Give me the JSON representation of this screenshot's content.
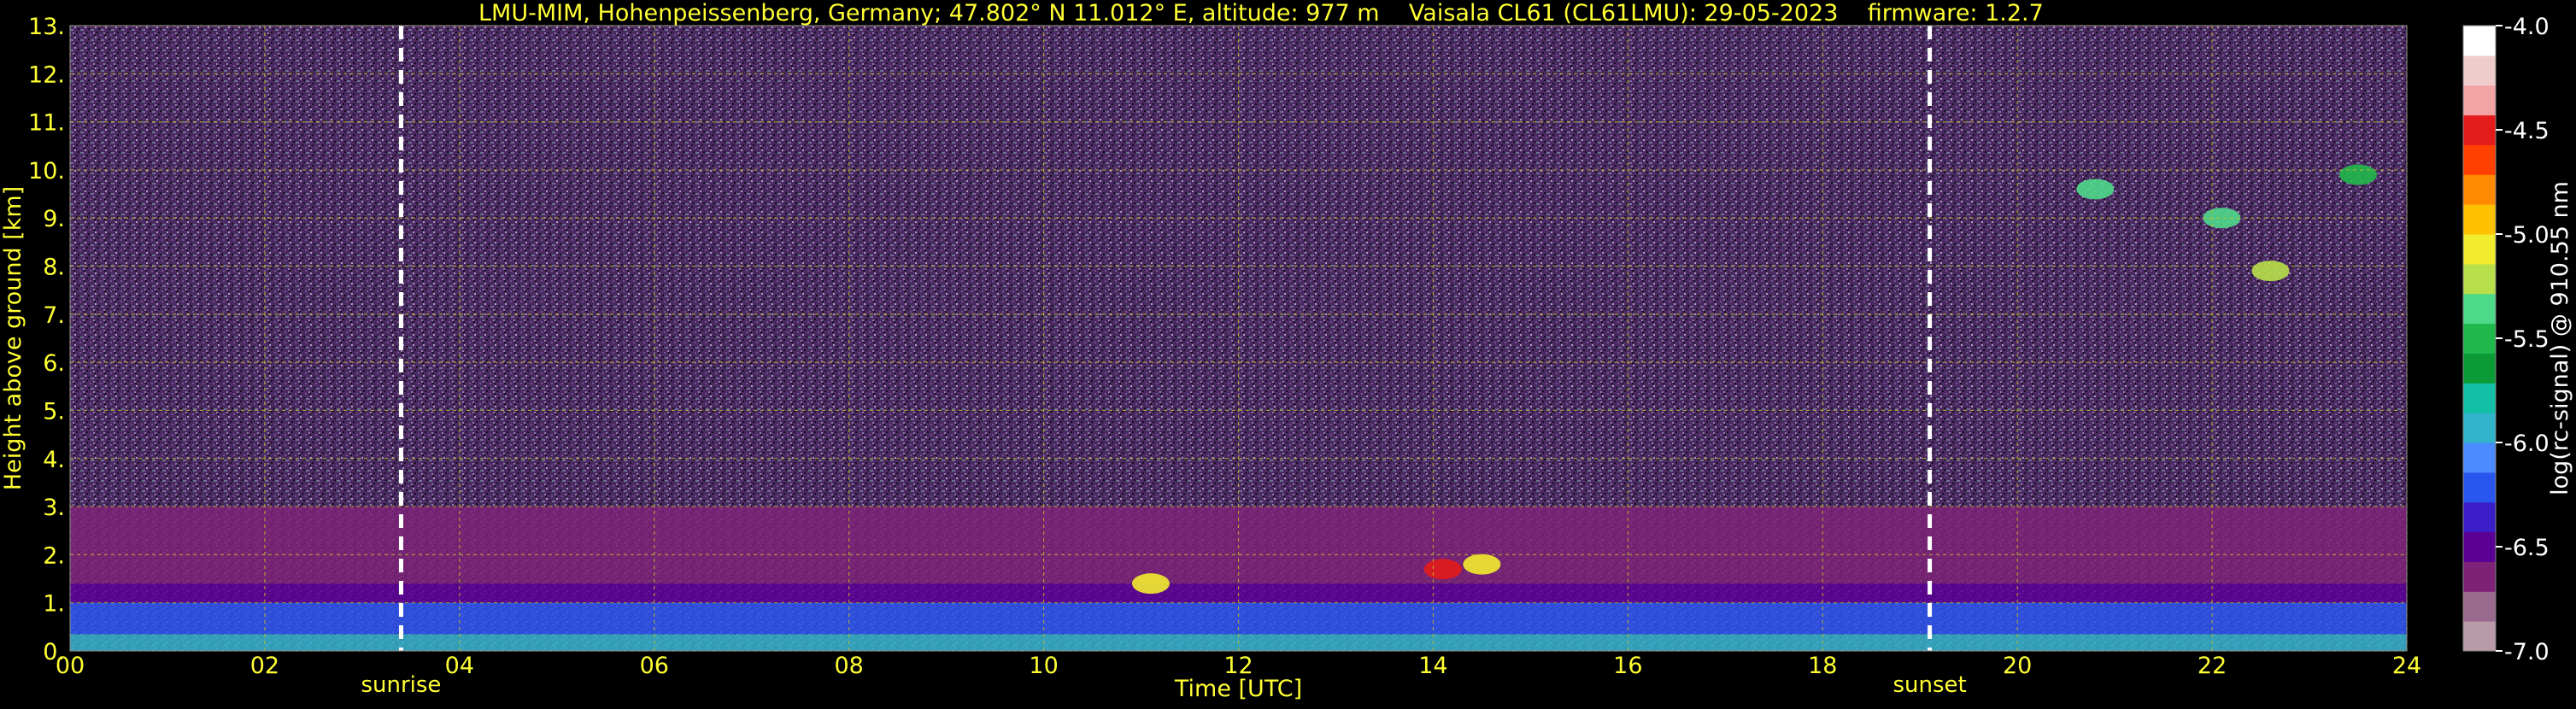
{
  "chart_data": {
    "type": "heatmap",
    "title": "LMU-MIM, Hohenpeissenberg, Germany; 47.802° N 11.012° E, altitude: 977 m    Vaisala CL61 (CL61LMU): 29-05-2023    firmware: 1.2.7",
    "xlabel": "Time [UTC]",
    "ylabel": "Height above ground [km]",
    "xlim": [
      0,
      24
    ],
    "ylim": [
      0,
      13
    ],
    "x_ticks": [
      "00",
      "02",
      "04",
      "06",
      "08",
      "10",
      "12",
      "14",
      "16",
      "18",
      "20",
      "22",
      "24"
    ],
    "y_ticks": [
      "0.",
      "1.",
      "2.",
      "3.",
      "4.",
      "5.",
      "6.",
      "7.",
      "8.",
      "9.",
      "10.",
      "11.",
      "12.",
      "13."
    ],
    "grid": true,
    "events": [
      {
        "label": "sunrise",
        "time": 3.4
      },
      {
        "label": "sunset",
        "time": 19.1
      }
    ],
    "colorbar": {
      "label": "log(rc-signal) @ 910.55 nm",
      "range": [
        -7.0,
        -4.0
      ],
      "ticks": [
        "-4.0",
        "-4.5",
        "-5.0",
        "-5.5",
        "-6.0",
        "-6.5",
        "-7.0"
      ],
      "colors": [
        "#b89aa8",
        "#9a6a8e",
        "#7d2277",
        "#5b0095",
        "#3b1ec8",
        "#2a56f0",
        "#4a8cff",
        "#31b3c9",
        "#12c0a6",
        "#0b9a35",
        "#21b84c",
        "#4fd98b",
        "#b8e04a",
        "#f2ec2e",
        "#ffc200",
        "#ff8a00",
        "#ff4000",
        "#e31b1b",
        "#f2a3a3",
        "#efcccc",
        "#ffffff"
      ]
    },
    "layers": [
      {
        "description_free": true,
        "from_km": 0.0,
        "to_km": 0.35,
        "level": -5.9
      },
      {
        "from_km": 0.35,
        "to_km": 1.0,
        "level": -6.2
      },
      {
        "from_km": 1.0,
        "to_km": 1.4,
        "level": -6.5
      },
      {
        "from_km": 1.4,
        "to_km": 3.0,
        "level": -6.7
      }
    ],
    "clouds": [
      {
        "t": 20.8,
        "h": 9.6,
        "level": -5.3
      },
      {
        "t": 22.1,
        "h": 9.0,
        "level": -5.4
      },
      {
        "t": 22.6,
        "h": 7.9,
        "level": -5.2
      },
      {
        "t": 23.5,
        "h": 9.9,
        "level": -5.5
      },
      {
        "t": 11.1,
        "h": 1.4,
        "level": -5.1
      },
      {
        "t": 14.1,
        "h": 1.7,
        "level": -4.4
      },
      {
        "t": 14.5,
        "h": 1.8,
        "level": -5.0
      }
    ]
  }
}
